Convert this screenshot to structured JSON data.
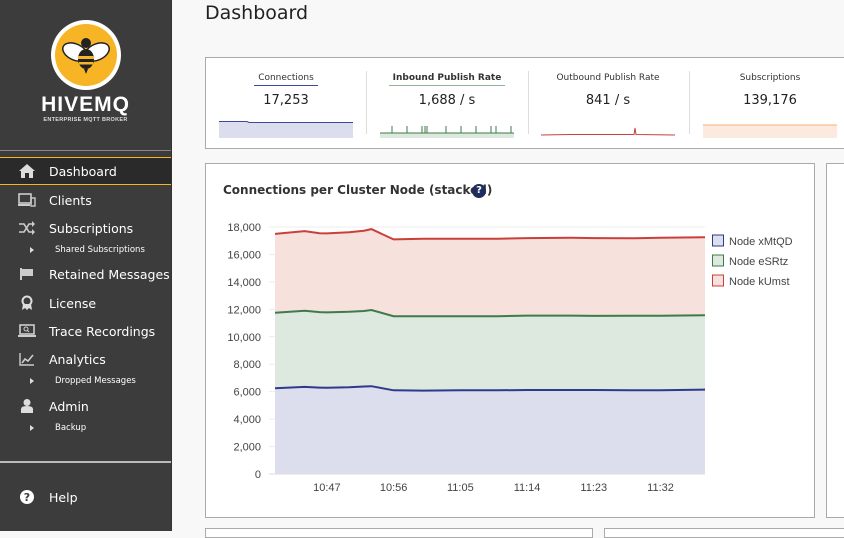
{
  "brand": {
    "name": "HIVEMQ",
    "tagline": "ENTERPRISE MQTT BROKER",
    "accent": "#f7b526"
  },
  "sidebar": {
    "items": [
      {
        "label": "Dashboard",
        "icon": "home-icon",
        "active": true
      },
      {
        "label": "Clients",
        "icon": "devices-icon"
      },
      {
        "label": "Subscriptions",
        "icon": "shuffle-icon"
      },
      {
        "label": "Shared Subscriptions",
        "sub": true
      },
      {
        "label": "Retained Messages",
        "icon": "flag-icon"
      },
      {
        "label": "License",
        "icon": "award-icon"
      },
      {
        "label": "Trace Recordings",
        "icon": "laptop-search-icon"
      },
      {
        "label": "Analytics",
        "icon": "line-chart-icon"
      },
      {
        "label": "Dropped Messages",
        "sub": true
      },
      {
        "label": "Admin",
        "icon": "user-icon"
      },
      {
        "label": "Backup",
        "sub": true
      }
    ],
    "help": {
      "label": "Help",
      "icon": "question-circle-icon"
    }
  },
  "page": {
    "title": "Dashboard"
  },
  "stats": [
    {
      "label": "Connections",
      "value": "17,253",
      "color": "#3d4a9c",
      "fill": "#dcdeee",
      "underline": true
    },
    {
      "label": "Inbound Publish Rate",
      "value": "1,688 / s",
      "color": "#3f7a4a",
      "fill": "#dde8df",
      "underline": true
    },
    {
      "label": "Outbound Publish Rate",
      "value": "841 / s",
      "color": "#c9403a",
      "fill": "#f6e1dd",
      "underline": false
    },
    {
      "label": "Subscriptions",
      "value": "139,176",
      "color": "#f0b080",
      "fill": "#fbeadd",
      "underline": false
    }
  ],
  "chart_data": {
    "type": "area",
    "stacked": true,
    "title": "Connections per Cluster Node (stacked)",
    "xlabel": "",
    "ylabel": "",
    "ylim": [
      0,
      18000
    ],
    "yticks": [
      "0",
      "2,000",
      "4,000",
      "6,000",
      "8,000",
      "10,000",
      "12,000",
      "14,000",
      "16,000",
      "18,000"
    ],
    "xticks": [
      "10:47",
      "10:56",
      "11:05",
      "11:14",
      "11:23",
      "11:32"
    ],
    "x": [
      "10:40",
      "10:44",
      "10:46",
      "10:47",
      "10:50",
      "10:52",
      "10:53",
      "10:56",
      "11:00",
      "11:05",
      "11:10",
      "11:14",
      "11:20",
      "11:23",
      "11:28",
      "11:32",
      "11:38"
    ],
    "series": [
      {
        "name": "Node xMtQD",
        "color": "#2e3a8c",
        "fill": "#dcdeee",
        "values": [
          6250,
          6350,
          6300,
          6280,
          6320,
          6380,
          6400,
          6100,
          6080,
          6100,
          6100,
          6120,
          6120,
          6120,
          6100,
          6100,
          6150
        ]
      },
      {
        "name": "Node eSRtz",
        "color": "#3f7a4a",
        "fill": "#dde8df",
        "values": [
          5500,
          5550,
          5500,
          5500,
          5500,
          5500,
          5550,
          5400,
          5420,
          5400,
          5400,
          5420,
          5420,
          5400,
          5430,
          5430,
          5420
        ]
      },
      {
        "name": "Node kUmst",
        "color": "#c9403a",
        "fill": "#f6e1dd",
        "values": [
          5750,
          5800,
          5750,
          5750,
          5800,
          5850,
          5900,
          5600,
          5650,
          5650,
          5650,
          5650,
          5670,
          5670,
          5650,
          5680,
          5680
        ]
      }
    ],
    "grid": true,
    "legend": "right"
  }
}
